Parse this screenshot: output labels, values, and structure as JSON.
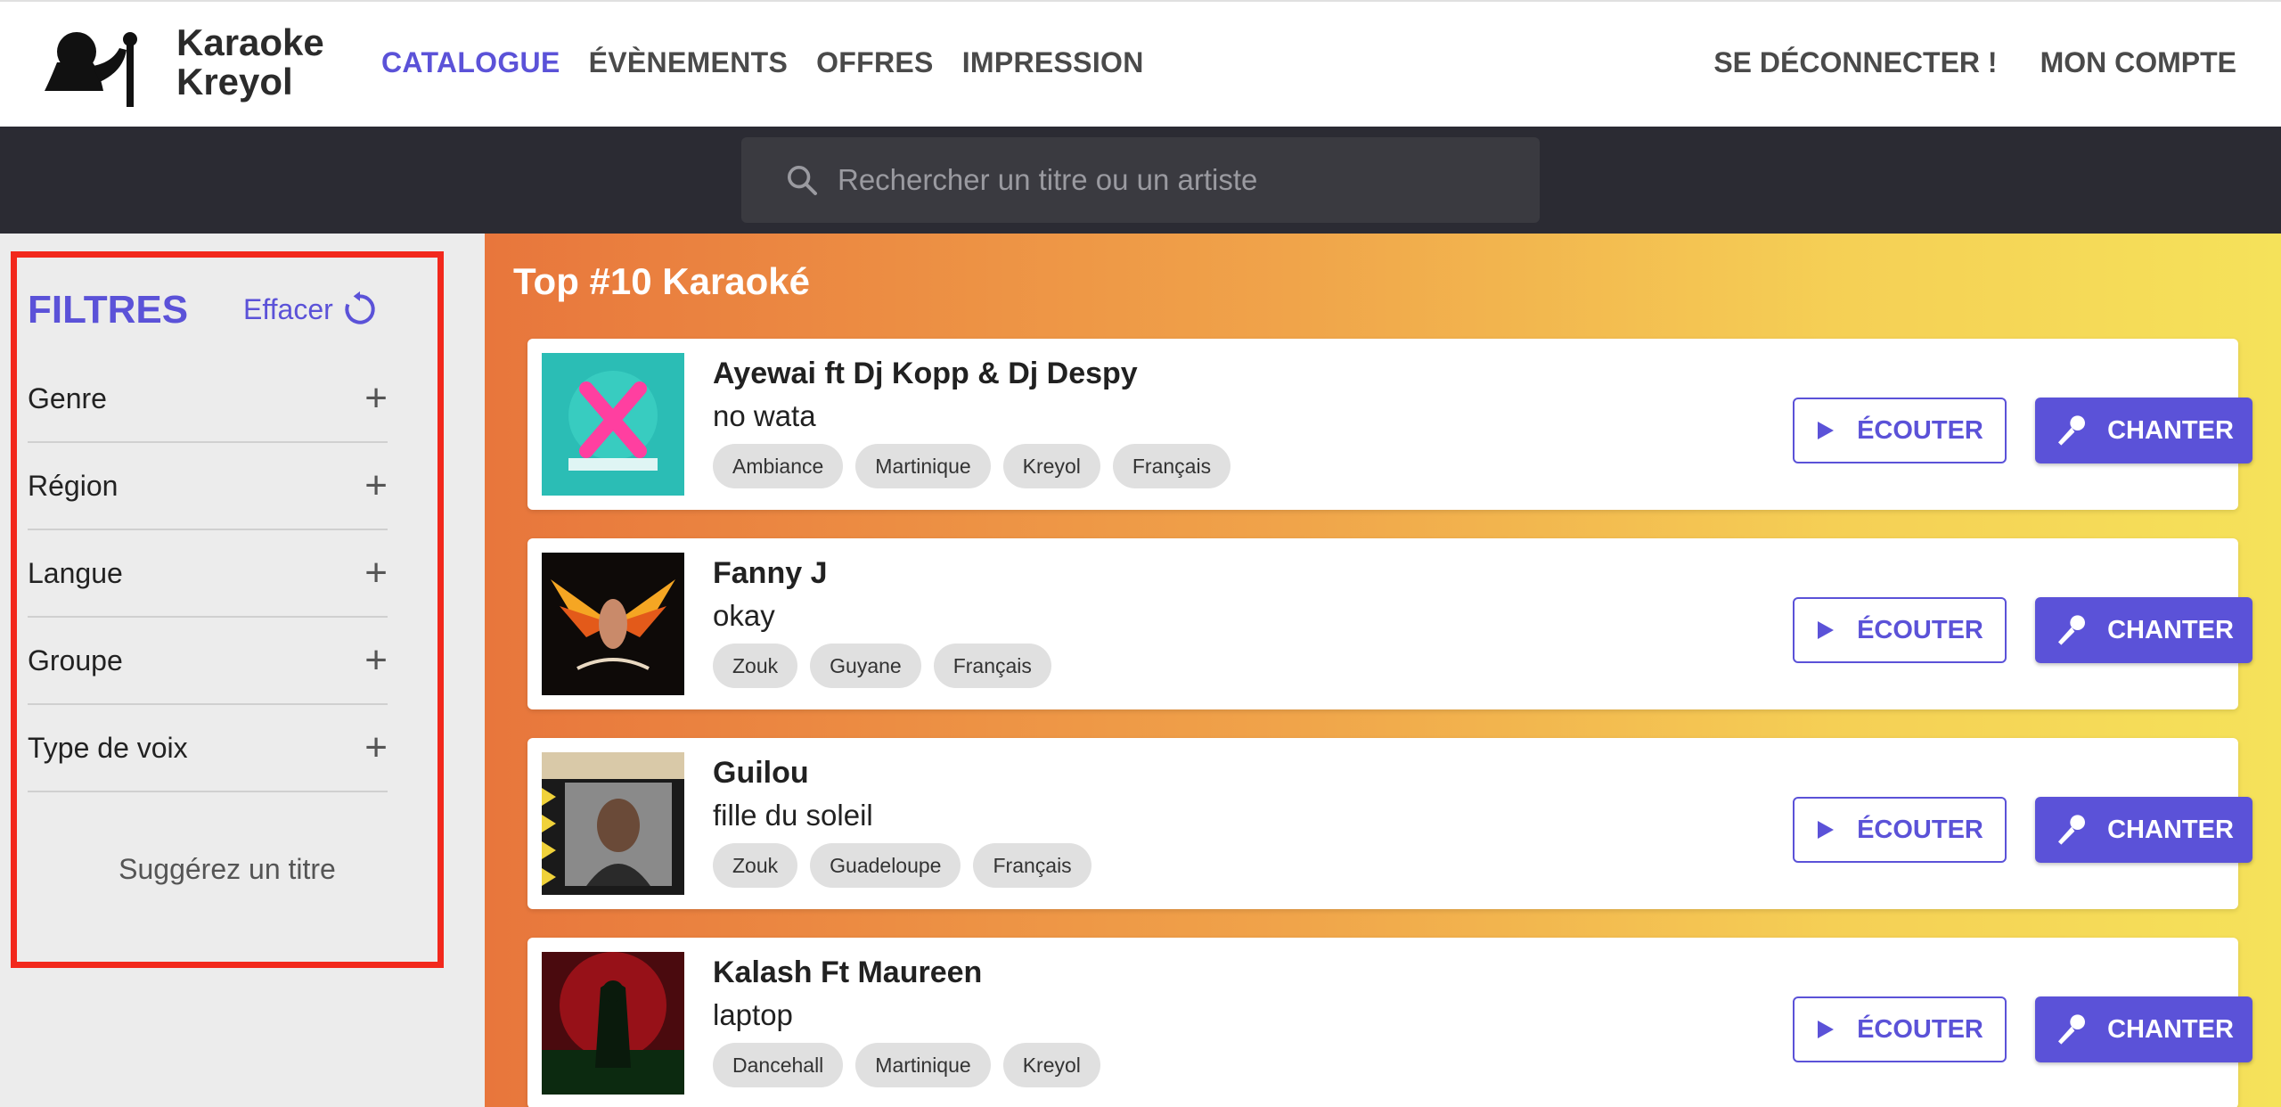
{
  "header": {
    "brand_line1": "Karaoke",
    "brand_line2": "Kreyol",
    "nav": [
      "CATALOGUE",
      "ÉVÈNEMENTS",
      "OFFRES",
      "IMPRESSION"
    ],
    "nav_right": [
      "SE DÉCONNECTER !",
      "MON COMPTE"
    ]
  },
  "search": {
    "placeholder": "Rechercher un titre ou un artiste"
  },
  "sidebar": {
    "title": "FILTRES",
    "clear_label": "Effacer",
    "filters": [
      "Genre",
      "Région",
      "Langue",
      "Groupe",
      "Type de voix"
    ],
    "suggest_label": "Suggérez un titre"
  },
  "main": {
    "title": "Top #10 Karaoké",
    "listen_label": "ÉCOUTER",
    "sing_label": "CHANTER",
    "songs": [
      {
        "artist": "Ayewai ft Dj Kopp & Dj Despy",
        "title": "no wata",
        "tags": [
          "Ambiance",
          "Martinique",
          "Kreyol",
          "Français"
        ]
      },
      {
        "artist": "Fanny J",
        "title": "okay",
        "tags": [
          "Zouk",
          "Guyane",
          "Français"
        ]
      },
      {
        "artist": "Guilou",
        "title": "fille du soleil",
        "tags": [
          "Zouk",
          "Guadeloupe",
          "Français"
        ]
      },
      {
        "artist": "Kalash Ft Maureen",
        "title": "laptop",
        "tags": [
          "Dancehall",
          "Martinique",
          "Kreyol"
        ]
      }
    ]
  },
  "colors": {
    "accent": "#5b52d8",
    "highlight_border": "#f2281c",
    "dark_band": "#2b2b33"
  }
}
